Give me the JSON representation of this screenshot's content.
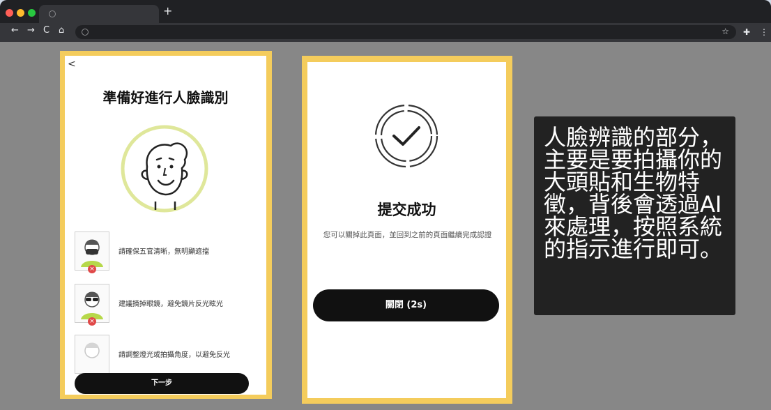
{
  "browser": {
    "tab_title": "",
    "new_tab_label": "+",
    "address": "",
    "nav": {
      "back": "←",
      "forward": "→",
      "reload": "C",
      "home": "⌂"
    },
    "star_label": "☆",
    "extensions_label": "✚",
    "menu_label": "⋮"
  },
  "screen1": {
    "back_label": "<",
    "title": "準備好進行人臉識別",
    "tips": [
      {
        "text": "請確保五官清晰，無明顯遮擋",
        "has_error": true
      },
      {
        "text": "建議摘掉眼鏡，避免鏡片反光眩光",
        "has_error": true
      },
      {
        "text": "請調整燈光或拍攝角度，以避免反光",
        "has_error": false
      }
    ],
    "error_mark": "×",
    "next_button": "下一步"
  },
  "screen2": {
    "title": "提交成功",
    "description": "您可以關掉此頁面，並回到之前的頁面繼續完成認證",
    "close_button": "關閉 (2s)"
  },
  "note": {
    "text": "人臉辨識的部分，主要是要拍攝你的大頭貼和生物特徵，背後會透過AI來處理，按照系統的指示進行即可。"
  },
  "colors": {
    "panel_border": "#f4cc5c",
    "page_background": "#878787",
    "note_background": "#222222",
    "face_ring": "#dfe79a"
  }
}
